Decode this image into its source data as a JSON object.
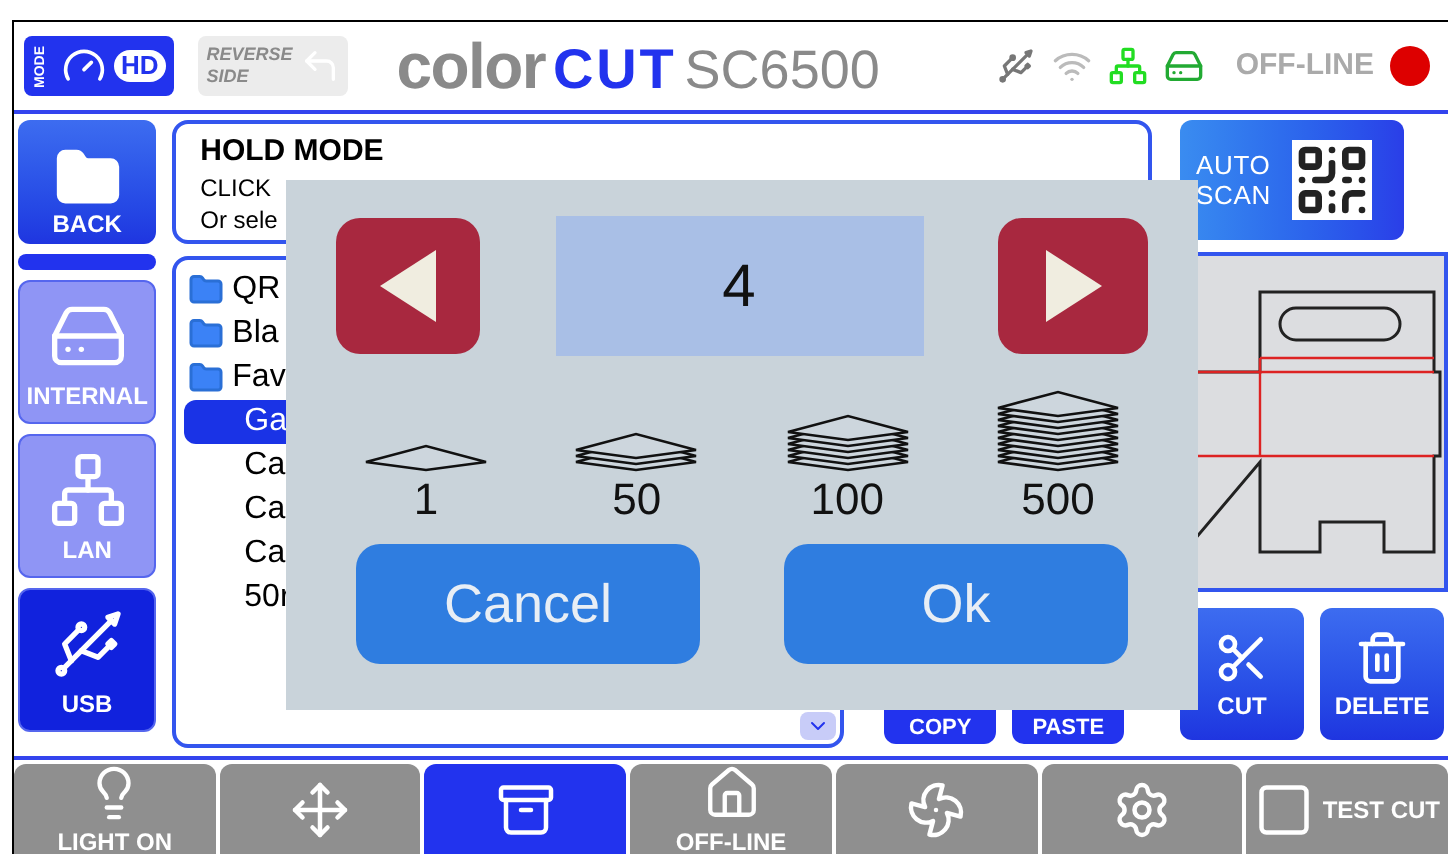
{
  "header": {
    "mode_label": "MODE",
    "hd_label": "HD",
    "reverse_side": {
      "lines": [
        "REVERSE",
        "SIDE"
      ],
      "disabled": true
    },
    "brand": "color",
    "brand_accent": "CUT",
    "model": "SC6500",
    "status": "OFF-LINE",
    "online": false
  },
  "back_button": {
    "label": "BACK"
  },
  "storage": [
    {
      "label": "INTERNAL",
      "kind": "drive",
      "selected": false
    },
    {
      "label": "LAN",
      "kind": "network",
      "selected": false
    },
    {
      "label": "USB",
      "kind": "usb",
      "selected": true
    }
  ],
  "info": {
    "title": "HOLD MODE",
    "lines": [
      "CLICK",
      "Or sele"
    ]
  },
  "files": [
    {
      "name": "QR",
      "kind": "folder",
      "selected": false
    },
    {
      "name": "Bla",
      "kind": "folder",
      "selected": false
    },
    {
      "name": "Fav",
      "kind": "folder",
      "selected": false
    },
    {
      "name": "Ga",
      "kind": "file",
      "selected": true
    },
    {
      "name": "Ca",
      "kind": "file",
      "selected": false
    },
    {
      "name": "Ca",
      "kind": "file",
      "selected": false
    },
    {
      "name": "Ca",
      "kind": "file",
      "selected": false
    },
    {
      "name": "50r",
      "kind": "file",
      "selected": false
    }
  ],
  "file_actions": [
    "COPY",
    "PASTE"
  ],
  "auto_scan": "AUTO SCAN",
  "right_actions": [
    {
      "label": "CUT",
      "kind": "cut"
    },
    {
      "label": "DELETE",
      "kind": "delete"
    }
  ],
  "toolbar": [
    {
      "kind": "light",
      "label": "LIGHT ON",
      "selected": false
    },
    {
      "kind": "move",
      "selected": false
    },
    {
      "kind": "files",
      "selected": true
    },
    {
      "kind": "home",
      "label": "OFF-LINE",
      "selected": false
    },
    {
      "kind": "fan",
      "selected": false
    },
    {
      "kind": "settings",
      "selected": false
    },
    {
      "kind": "test",
      "label": "TEST CUT",
      "selected": false
    }
  ],
  "dialog": {
    "value": "4",
    "presets": [
      "1",
      "50",
      "100",
      "500"
    ],
    "buttons": [
      "Cancel",
      "Ok"
    ]
  }
}
